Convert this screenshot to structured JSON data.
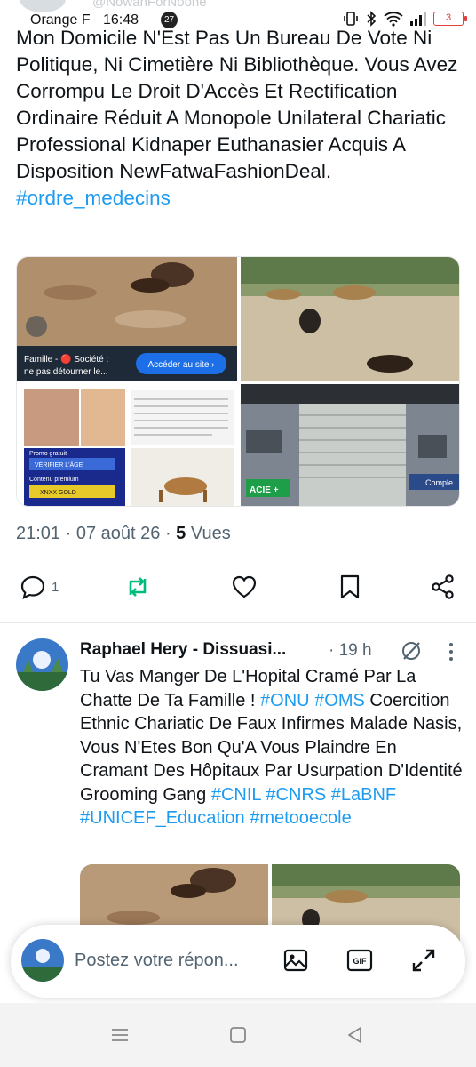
{
  "status_bar": {
    "carrier": "Orange F",
    "time": "16:48",
    "notification_count": "27",
    "battery_level": "3",
    "ghost_handle_partial": "@NowahForNoone"
  },
  "main_tweet": {
    "text": "Mon Domicile N'Est Pas Un Bureau De Vote Ni Politique, Ni Cimetière Ni Bibliothèque. Vous Avez Corrompu Le Droit D'Accès Et Rectification Ordinaire Réduit A Monopole Unilateral Chariatic Professional Kidnaper Euthanasier Acquis A Disposition NewFatwaFashionDeal.",
    "hashtag": "#ordre_medecins",
    "media": {
      "ad_caption": "Famille - 🔴 Société : ne pas détourner le...",
      "ad_button": "Accéder au site ›",
      "verify_promo": "Promo gratuit",
      "verify_button": "VÉRIFIER L'ÂGE",
      "premium_label": "Contenu premium",
      "premium_button": "XNXX GOLD",
      "shop_sign": "ACIE",
      "building_sign": "Comple"
    },
    "time": "21:01",
    "date": "07 août 26",
    "views_count": "5",
    "views_label": "Vues",
    "reply_count": "1",
    "accent_color": "#1d9bf0",
    "retweet_color": "#00ba7c"
  },
  "reply": {
    "name": "Raphael Hery - Dissuasi...",
    "time": "· 19 h",
    "text_part1": "Tu Vas Manger De L'Hopital Cramé Par La Chatte De Ta Famille ! ",
    "hashtag1": "#ONU",
    "hashtag2": "#OMS",
    "text_part2": " Coercition Ethnic Chariatic De Faux Infirmes Malade Nasis, Vous N'Etes Bon Qu'A Vous Plaindre En Cramant Des Hôpitaux Par Usurpation D'Identité Grooming Gang ",
    "hashtag3": "#CNIL",
    "hashtag4": "#CNRS",
    "hashtag5": "#LaBNF",
    "hashtag6": "#UNICEF_Education",
    "hashtag7": "#metooecole"
  },
  "compose": {
    "placeholder": "Postez votre répon...",
    "gif_label": "GIF"
  },
  "icons": [
    "reply-icon",
    "retweet-icon",
    "like-icon",
    "bookmark-icon",
    "share-icon",
    "grok-icon",
    "more-icon",
    "image-icon",
    "gif-icon",
    "expand-icon",
    "recent-apps-icon",
    "home-icon",
    "back-icon"
  ]
}
